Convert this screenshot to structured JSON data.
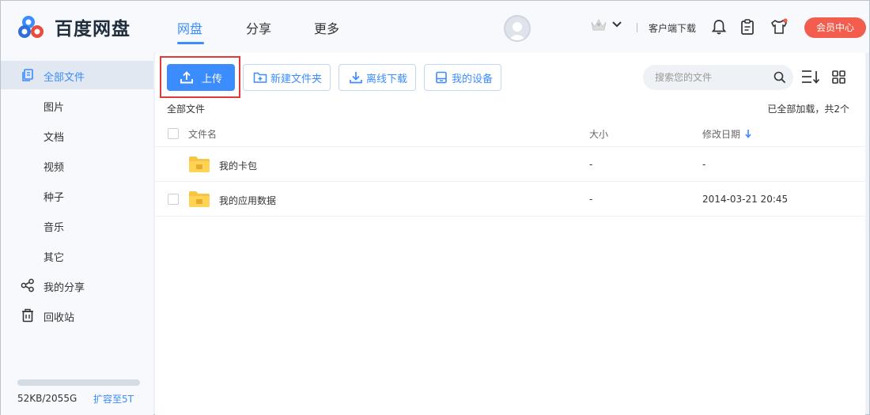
{
  "header": {
    "logo_text": "百度网盘",
    "nav": [
      {
        "label": "网盘",
        "active": true
      },
      {
        "label": "分享",
        "active": false
      },
      {
        "label": "更多",
        "active": false
      }
    ],
    "client_download": "客户端下载",
    "vip_button": "会员中心",
    "accent": "#3b8cff",
    "vip_color": "#f25d4e"
  },
  "sidebar": {
    "items": [
      {
        "label": "全部文件",
        "icon": "files-icon",
        "active": true
      },
      {
        "label": "图片"
      },
      {
        "label": "文档"
      },
      {
        "label": "视频"
      },
      {
        "label": "种子"
      },
      {
        "label": "音乐"
      },
      {
        "label": "其它"
      },
      {
        "label": "我的分享",
        "icon": "share-icon"
      },
      {
        "label": "回收站",
        "icon": "trash-icon"
      }
    ],
    "quota_text": "52KB/2055G",
    "quota_link": "扩容至5T",
    "quota_fraction": 0
  },
  "toolbar": {
    "upload": "上传",
    "new_folder": "新建文件夹",
    "offline_download": "离线下载",
    "my_devices": "我的设备",
    "search_placeholder": "搜索您的文件"
  },
  "list": {
    "breadcrumb": "全部文件",
    "status": "已全部加载，共2个",
    "columns": {
      "name": "文件名",
      "size": "大小",
      "modified": "修改日期"
    },
    "rows": [
      {
        "name": "我的卡包",
        "size": "-",
        "modified": "-"
      },
      {
        "name": "我的应用数据",
        "size": "-",
        "modified": "2014-03-21 20:45"
      }
    ]
  }
}
